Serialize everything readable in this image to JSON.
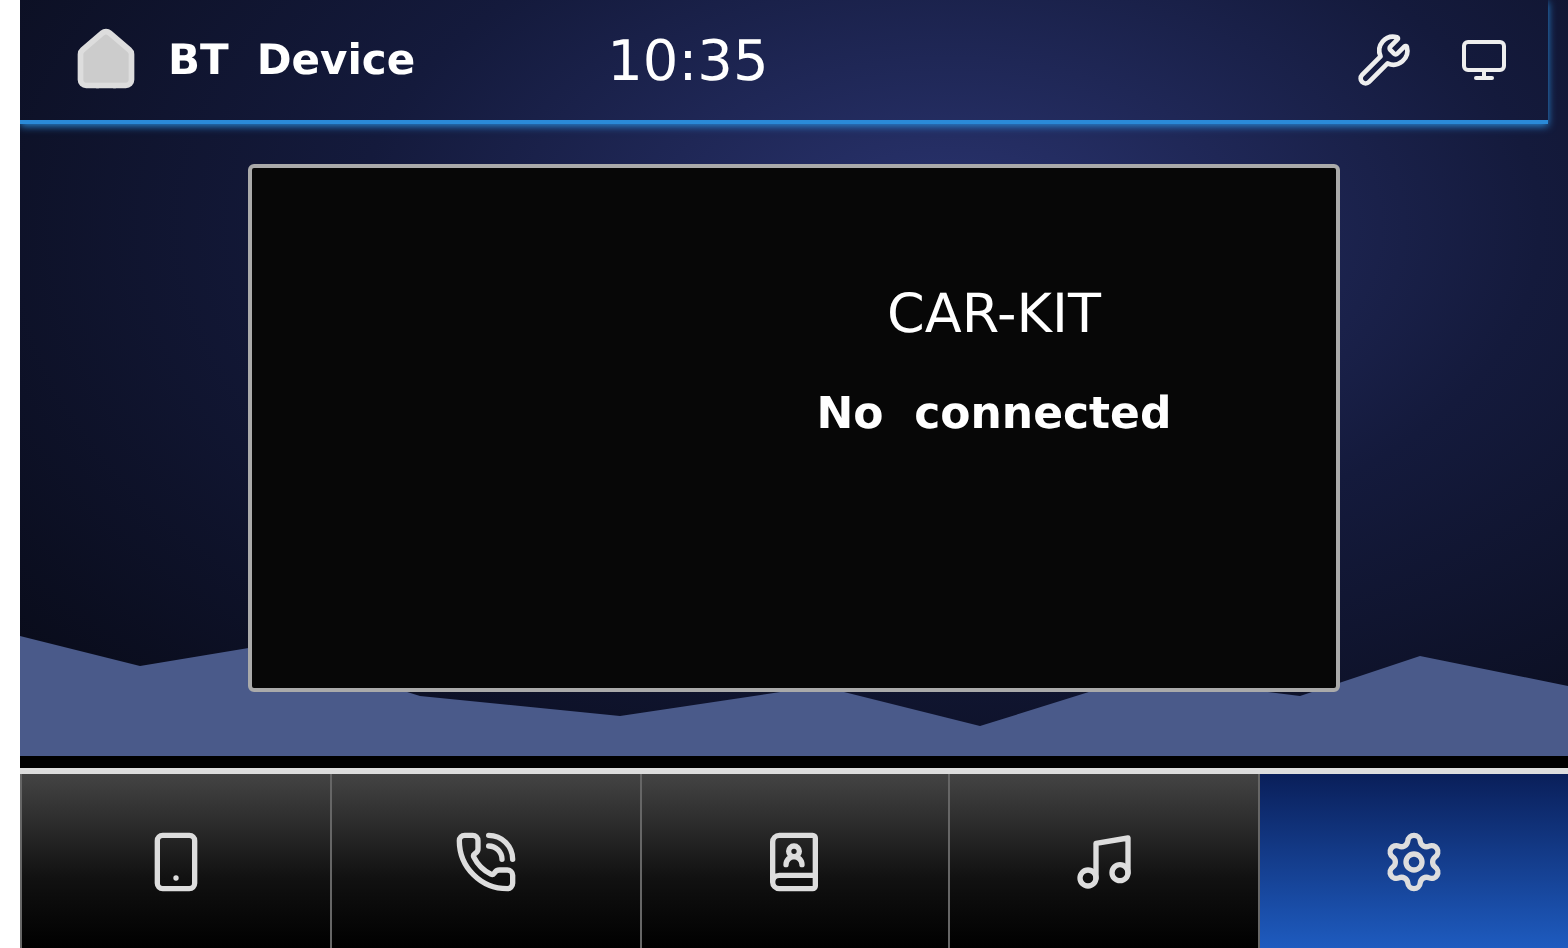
{
  "header": {
    "section": "BT",
    "title": "Device",
    "time": "10:35"
  },
  "dialog": {
    "title": "CAR-KIT",
    "message": "No  connected"
  },
  "tabs": [
    {
      "kind": "phone",
      "selected": false
    },
    {
      "kind": "calls",
      "selected": false
    },
    {
      "kind": "contacts",
      "selected": false
    },
    {
      "kind": "music",
      "selected": false
    },
    {
      "kind": "settings",
      "selected": true
    }
  ]
}
